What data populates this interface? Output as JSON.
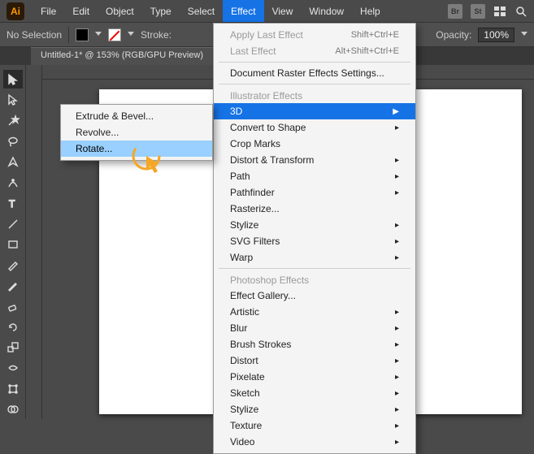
{
  "menubar": {
    "items": [
      "File",
      "Edit",
      "Object",
      "Type",
      "Select",
      "Effect",
      "View",
      "Window",
      "Help"
    ],
    "activeIndex": 5,
    "rightIcons": {
      "bridge": "Br",
      "stock": "St"
    }
  },
  "controlbar": {
    "selection": "No Selection",
    "strokeLabel": "Stroke:",
    "opacityLabel": "Opacity:",
    "opacityValue": "100%"
  },
  "document": {
    "tabTitle": "Untitled-1* @ 153% (RGB/GPU Preview)"
  },
  "effectMenu": {
    "applyLast": {
      "label": "Apply Last Effect",
      "kbd": "Shift+Ctrl+E"
    },
    "lastEffect": {
      "label": "Last Effect",
      "kbd": "Alt+Shift+Ctrl+E"
    },
    "rasterSettings": "Document Raster Effects Settings...",
    "sectionIllustrator": "Illustrator Effects",
    "illustratorItems": [
      {
        "label": "3D",
        "sub": true,
        "highlight": true
      },
      {
        "label": "Convert to Shape",
        "sub": true
      },
      {
        "label": "Crop Marks",
        "sub": false
      },
      {
        "label": "Distort & Transform",
        "sub": true
      },
      {
        "label": "Path",
        "sub": true
      },
      {
        "label": "Pathfinder",
        "sub": true
      },
      {
        "label": "Rasterize...",
        "sub": false
      },
      {
        "label": "Stylize",
        "sub": true
      },
      {
        "label": "SVG Filters",
        "sub": true
      },
      {
        "label": "Warp",
        "sub": true
      }
    ],
    "sectionPhotoshop": "Photoshop Effects",
    "photoshopItems": [
      {
        "label": "Effect Gallery...",
        "sub": false
      },
      {
        "label": "Artistic",
        "sub": true
      },
      {
        "label": "Blur",
        "sub": true
      },
      {
        "label": "Brush Strokes",
        "sub": true
      },
      {
        "label": "Distort",
        "sub": true
      },
      {
        "label": "Pixelate",
        "sub": true
      },
      {
        "label": "Sketch",
        "sub": true
      },
      {
        "label": "Stylize",
        "sub": true
      },
      {
        "label": "Texture",
        "sub": true
      },
      {
        "label": "Video",
        "sub": true
      }
    ]
  },
  "submenu3d": {
    "items": [
      {
        "label": "Extrude & Bevel..."
      },
      {
        "label": "Revolve..."
      },
      {
        "label": "Rotate...",
        "highlight": true
      }
    ]
  },
  "logoText": "Ai"
}
